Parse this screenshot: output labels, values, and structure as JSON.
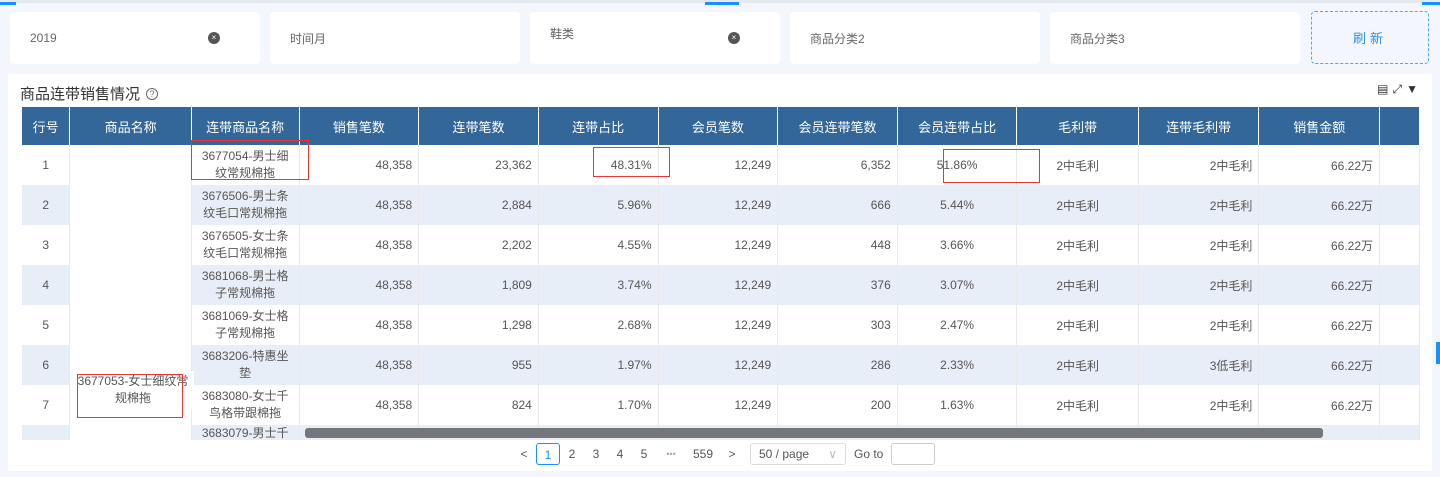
{
  "filters": [
    {
      "value": "2019",
      "clearable": true
    },
    {
      "value": "时间月",
      "clearable": false
    },
    {
      "value": "鞋类",
      "clearable": true
    },
    {
      "value": "商品分类2",
      "clearable": false
    },
    {
      "value": "商品分类3",
      "clearable": false
    }
  ],
  "refresh_label": "刷新",
  "panel": {
    "title": "商品连带销售情况",
    "help_icon": "?"
  },
  "icons": {
    "list": "list-icon",
    "expand": "expand-icon",
    "filter": "filter-icon"
  },
  "table": {
    "headers": [
      "行号",
      "商品名称",
      "连带商品名称",
      "销售笔数",
      "连带笔数",
      "连带占比",
      "会员笔数",
      "会员连带笔数",
      "会员连带占比",
      "毛利带",
      "连带毛利带",
      "销售金额",
      ""
    ],
    "product_name": "3677053-女士细纹常规棉拖",
    "rows": [
      [
        "1",
        "3677054-男士细纹常规棉拖",
        "48,358",
        "23,362",
        "48.31%",
        "12,249",
        "6,352",
        "51.86%",
        "2中毛利",
        "2中毛利",
        "66.22万"
      ],
      [
        "2",
        "3676506-男士条纹毛口常规棉拖",
        "48,358",
        "2,884",
        "5.96%",
        "12,249",
        "666",
        "5.44%",
        "2中毛利",
        "2中毛利",
        "66.22万"
      ],
      [
        "3",
        "3676505-女士条纹毛口常规棉拖",
        "48,358",
        "2,202",
        "4.55%",
        "12,249",
        "448",
        "3.66%",
        "2中毛利",
        "2中毛利",
        "66.22万"
      ],
      [
        "4",
        "3681068-男士格子常规棉拖",
        "48,358",
        "1,809",
        "3.74%",
        "12,249",
        "376",
        "3.07%",
        "2中毛利",
        "2中毛利",
        "66.22万"
      ],
      [
        "5",
        "3681069-女士格子常规棉拖",
        "48,358",
        "1,298",
        "2.68%",
        "12,249",
        "303",
        "2.47%",
        "2中毛利",
        "2中毛利",
        "66.22万"
      ],
      [
        "6",
        "3683206-特惠坐垫",
        "48,358",
        "955",
        "1.97%",
        "12,249",
        "286",
        "2.33%",
        "2中毛利",
        "3低毛利",
        "66.22万"
      ],
      [
        "7",
        "3683080-女士千鸟格带跟棉拖",
        "48,358",
        "824",
        "1.70%",
        "12,249",
        "200",
        "1.63%",
        "2中毛利",
        "2中毛利",
        "66.22万"
      ],
      [
        "",
        "3683079-男士千",
        "",
        "",
        "",
        "",
        "",
        "",
        "",
        "",
        ""
      ]
    ]
  },
  "pagination": {
    "prev": "<",
    "pages": [
      "1",
      "2",
      "3",
      "4",
      "5"
    ],
    "ellipsis": "•••",
    "last": "559",
    "next": ">",
    "current": "1",
    "page_size": "50 / page",
    "goto_label": "Go to"
  }
}
